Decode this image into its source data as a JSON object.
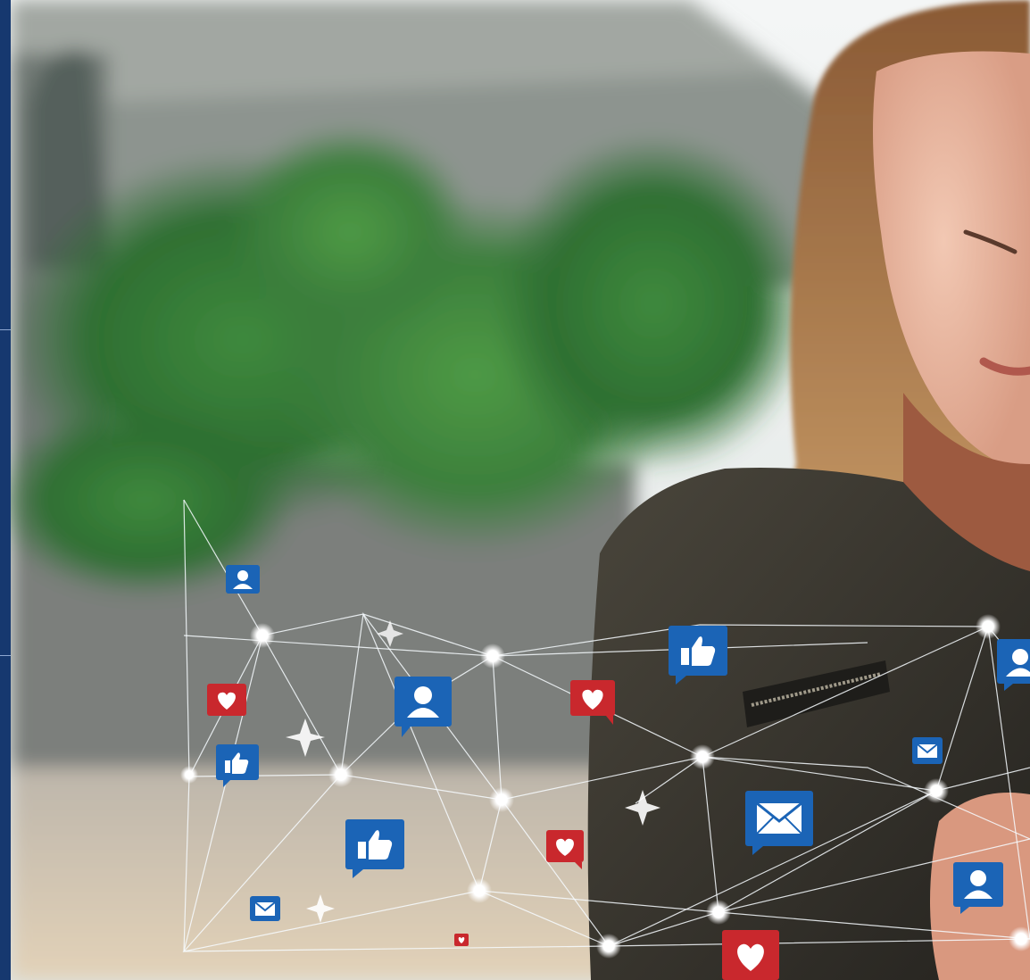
{
  "image": {
    "description_kind": "photo",
    "subject": "woman-using-smartphone",
    "overlay": "social-network-graph",
    "icons": [
      "thumbs-up-icon",
      "user-icon",
      "heart-icon",
      "mail-icon"
    ]
  },
  "colors": {
    "frame": "#16386f",
    "blue_badge": "#1b64b6",
    "red_badge": "#c9282d",
    "network_line": "#f7fbff",
    "sky": "#eef1f2"
  }
}
